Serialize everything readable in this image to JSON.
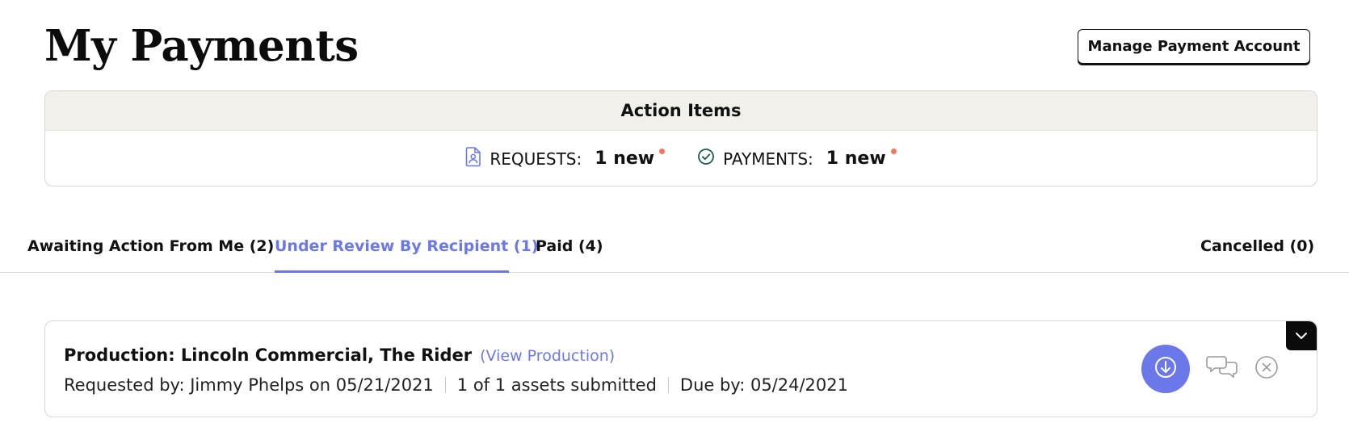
{
  "page": {
    "title": "My Payments",
    "manage_button": "Manage Payment Account"
  },
  "action_items": {
    "header": "Action Items",
    "requests": {
      "label": "REQUESTS:",
      "count": "1 new",
      "icon": "document-person-icon"
    },
    "payments": {
      "label": "PAYMENTS:",
      "count": "1 new",
      "icon": "check-circle-icon"
    }
  },
  "tabs": [
    {
      "label": "Awaiting Action From Me (2)",
      "active": false
    },
    {
      "label": "Under Review By Recipient (1)",
      "active": true
    },
    {
      "label": "Paid (4)",
      "active": false
    },
    {
      "label": "Cancelled (0)",
      "active": false
    }
  ],
  "payment_card": {
    "title": "Production: Lincoln Commercial, The Rider",
    "view_link": "(View Production)",
    "requested_by": "Requested by: Jimmy Phelps on 05/21/2021",
    "assets": "1 of 1 assets submitted",
    "due": "Due by: 05/24/2021",
    "actions": [
      "download-icon",
      "chat-icon",
      "close-circle-icon",
      "chevron-down-icon"
    ]
  },
  "colors": {
    "accent": "#6b78ea",
    "notification_dot": "#f2775c",
    "header_bg": "#f1f0eb",
    "check_icon": "#1a5c4a"
  }
}
